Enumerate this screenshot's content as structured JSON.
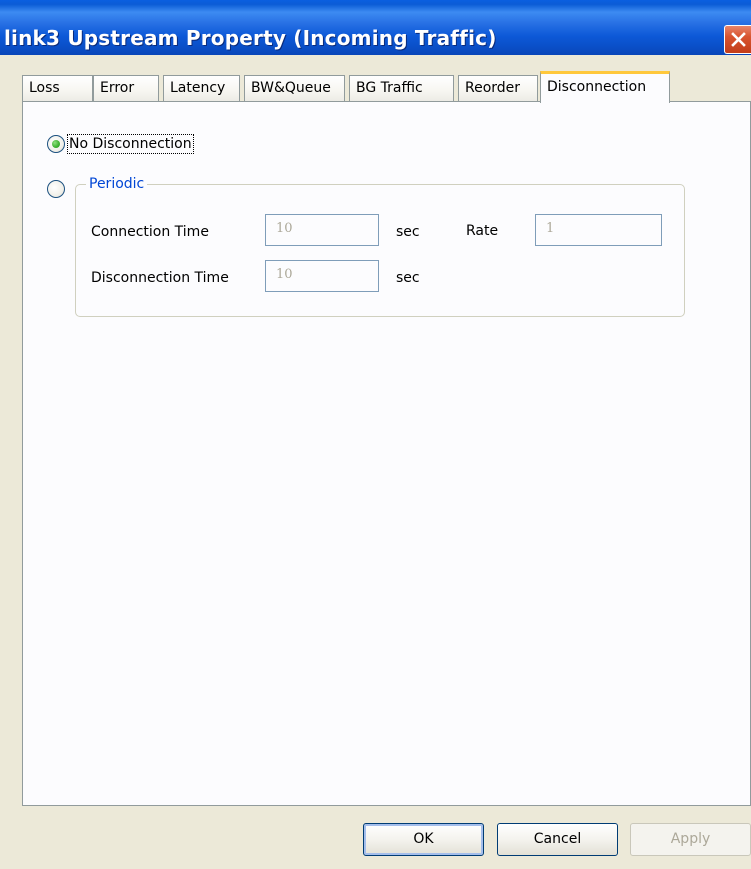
{
  "window": {
    "title": "link3 Upstream Property (Incoming Traffic)"
  },
  "tabs": [
    {
      "label": "Loss",
      "active": false
    },
    {
      "label": "Error",
      "active": false
    },
    {
      "label": "Latency",
      "active": false
    },
    {
      "label": "BW&Queue",
      "active": false
    },
    {
      "label": "BG Traffic",
      "active": false
    },
    {
      "label": "Reorder",
      "active": false
    },
    {
      "label": "Disconnection",
      "active": true
    }
  ],
  "disconnection": {
    "no_disconnection_label": "No Disconnection",
    "no_disconnection_selected": true,
    "periodic_label": "Periodic",
    "periodic_selected": false,
    "connection_time_label": "Connection Time",
    "connection_time_value": "10",
    "connection_time_unit": "sec",
    "rate_label": "Rate",
    "rate_value": "1",
    "disconnection_time_label": "Disconnection Time",
    "disconnection_time_value": "10",
    "disconnection_time_unit": "sec"
  },
  "buttons": {
    "ok": "OK",
    "cancel": "Cancel",
    "apply": "Apply"
  },
  "icons": {
    "close": "close-icon"
  },
  "colors": {
    "titlebar": "#0A5FE0",
    "tab_highlight": "#FFC83C",
    "group_legend": "#0046D5",
    "radio_dot": "#3DB030",
    "close_button": "#D8542F"
  }
}
